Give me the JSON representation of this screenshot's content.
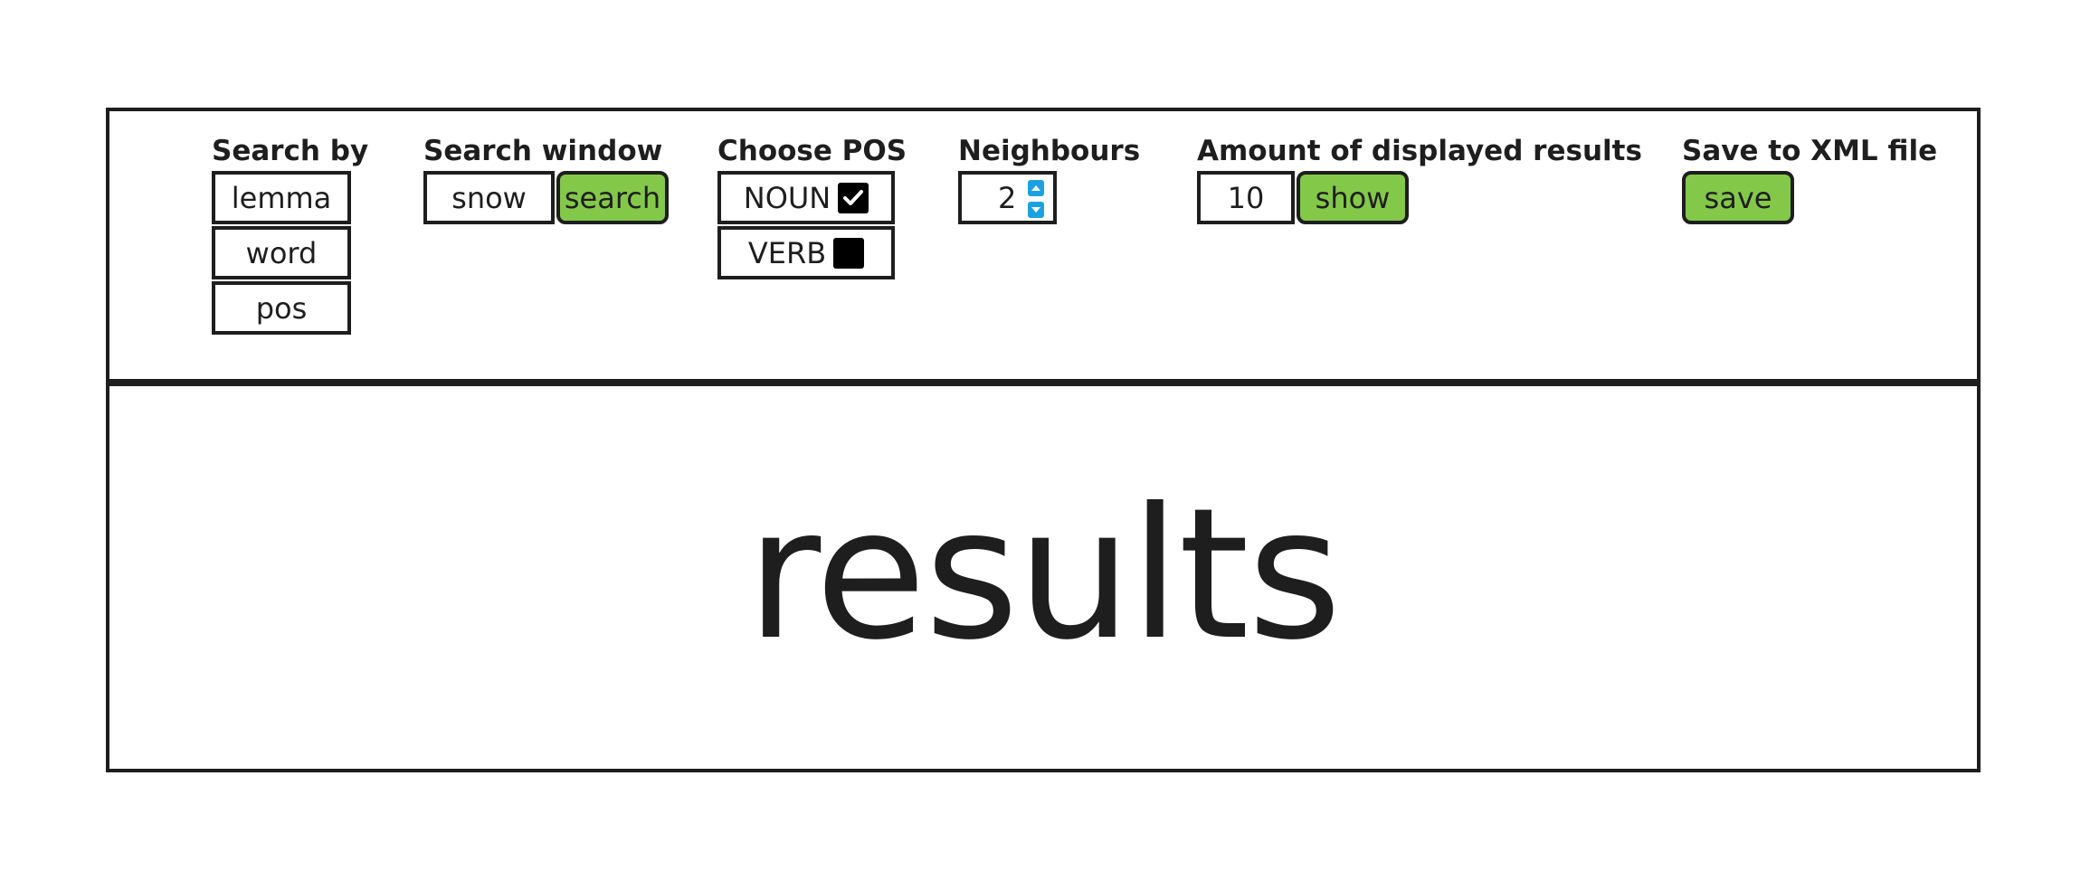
{
  "search_by": {
    "title": "Search by",
    "options": [
      {
        "label": "lemma"
      },
      {
        "label": "word"
      },
      {
        "label": "pos"
      }
    ]
  },
  "search_window": {
    "title": "Search window",
    "input_value": "snow",
    "button_label": "search"
  },
  "choose_pos": {
    "title": "Choose POS",
    "options": [
      {
        "label": "NOUN",
        "checked": true
      },
      {
        "label": "VERB",
        "checked": false
      }
    ]
  },
  "neighbours": {
    "title": "Neighbours",
    "value": "2"
  },
  "amount_results": {
    "title": "Amount of displayed results",
    "value": "10",
    "button_label": "show"
  },
  "save_xml": {
    "title": "Save to XML file",
    "button_label": "save"
  },
  "results": {
    "label": "results"
  },
  "colors": {
    "button_green": "#84c84a",
    "spinner_blue": "#1ba1e2",
    "border": "#1e1e1e"
  }
}
